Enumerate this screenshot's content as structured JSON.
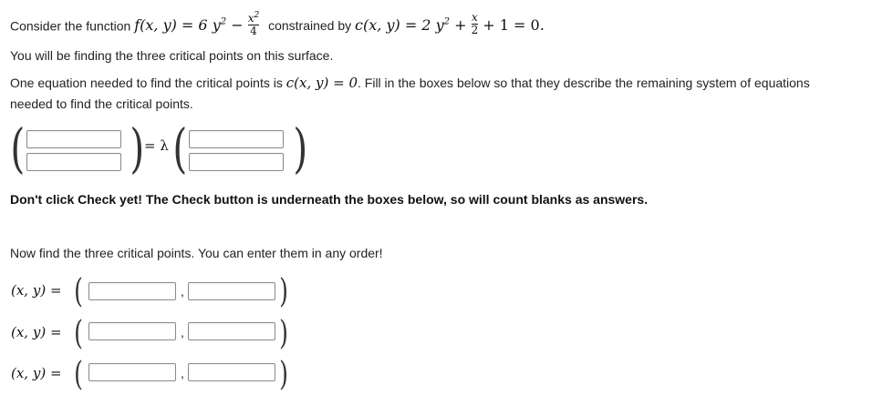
{
  "prompt": {
    "consider_prefix": "Consider the function",
    "f_lhs": "f(x, y) = 6 y",
    "sup2": "2",
    "minus": " − ",
    "frac_num": "x",
    "frac_den": "4",
    "constrained": "constrained by",
    "c_lhs": "c(x, y) = 2 y",
    "plus": " + ",
    "frac2_num": "x",
    "frac2_den": "2",
    "tail": "+ 1 = 0.",
    "line2": "You will be finding the three critical points on this surface.",
    "line3_prefix": "One equation needed to find the critical points is",
    "line3_math": "c(x, y) = 0",
    "line3_suffix": ". Fill in the boxes below so that they describe the remaining system of equations",
    "line4": "needed to find the critical points.",
    "lambda_eq": "= λ",
    "warning": "Don't click Check yet! The Check button is underneath the boxes below, so will count blanks as answers.",
    "line5": "Now find the three critical points. You can enter them in any order!",
    "xy_label": "(x, y) =",
    "comma": ","
  },
  "inputs": {
    "grad_f_1": "",
    "grad_f_2": "",
    "grad_c_1": "",
    "grad_c_2": "",
    "p1_x": "",
    "p1_y": "",
    "p2_x": "",
    "p2_y": "",
    "p3_x": "",
    "p3_y": ""
  }
}
